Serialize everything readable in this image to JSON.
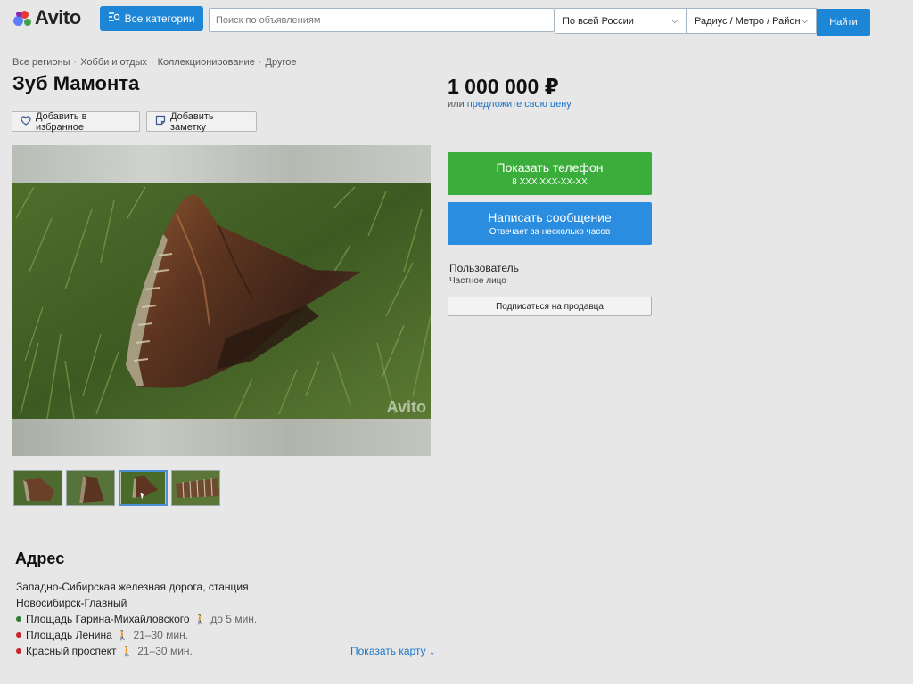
{
  "header": {
    "logo_text": "Avito",
    "categories_label": "Все категории",
    "search_placeholder": "Поиск по объявлениям",
    "region_select": "По всей России",
    "radius_select": "Радиус / Метро / Район",
    "find_label": "Найти"
  },
  "breadcrumbs": [
    "Все регионы",
    "Хобби и отдых",
    "Коллекционирование",
    "Другое"
  ],
  "listing": {
    "title": "Зуб Мамонта",
    "price": "1 000 000 ₽",
    "price_or": "или",
    "price_offer_link": "предложите свою цену",
    "favorite_label": "Добавить в избранное",
    "note_label": "Добавить заметку",
    "watermark": "Avito"
  },
  "contact": {
    "phone_label": "Показать телефон",
    "phone_masked": "8 XXX XXX-XX-XX",
    "message_label": "Написать сообщение",
    "message_sub": "Отвечает за несколько часов",
    "seller_name": "Пользователь",
    "seller_type": "Частное лицо",
    "subscribe_label": "Подписаться на продавца"
  },
  "address": {
    "heading": "Адрес",
    "text": "Западно-Сибирская железная дорога, станция Новосибирск-Главный",
    "metro": [
      {
        "name": "Площадь Гарина-Михайловского",
        "time": "до 5 мин.",
        "color": "#2e7d32"
      },
      {
        "name": "Площадь Ленина",
        "time": "21–30 мин.",
        "color": "#c62828"
      },
      {
        "name": "Красный проспект",
        "time": "21–30 мин.",
        "color": "#c62828"
      }
    ],
    "show_map": "Показать карту"
  },
  "colors": {
    "accent_blue": "#1e86d6",
    "phone_green": "#3aad3a",
    "message_blue": "#2b8de0",
    "link_blue": "#1e74c6"
  }
}
